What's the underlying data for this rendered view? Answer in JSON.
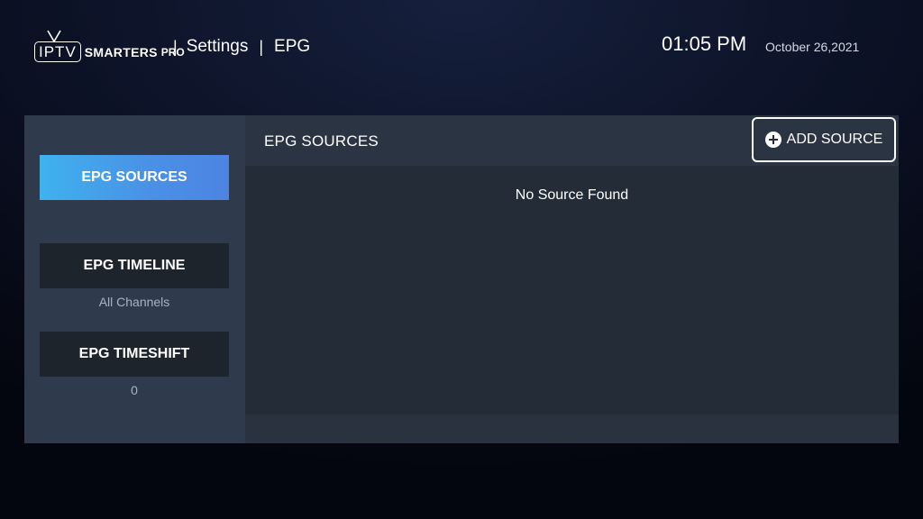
{
  "header": {
    "logo": {
      "iptv": "IPTV",
      "smarters": "SMARTERS",
      "pro": "PRO"
    },
    "breadcrumb": {
      "separator": "|",
      "section": "Settings",
      "page": "EPG"
    },
    "time": "01:05 PM",
    "date": "October 26,2021"
  },
  "sidebar": {
    "items": [
      {
        "label": "EPG SOURCES",
        "active": true,
        "sub": ""
      },
      {
        "label": "EPG TIMELINE",
        "active": false,
        "sub": "All Channels"
      },
      {
        "label": "EPG TIMESHIFT",
        "active": false,
        "sub": "0"
      }
    ]
  },
  "main": {
    "title": "EPG SOURCES",
    "add_button": {
      "icon": "plus-circle-icon",
      "label": "ADD SOURCE"
    },
    "empty_message": "No Source Found"
  },
  "colors": {
    "active_gradient_start": "#3fb2ee",
    "active_gradient_end": "#4d84e2",
    "sidebar_bg": "#2f3b4c",
    "content_bg": "#242c38",
    "button_bg": "#1e242c"
  }
}
